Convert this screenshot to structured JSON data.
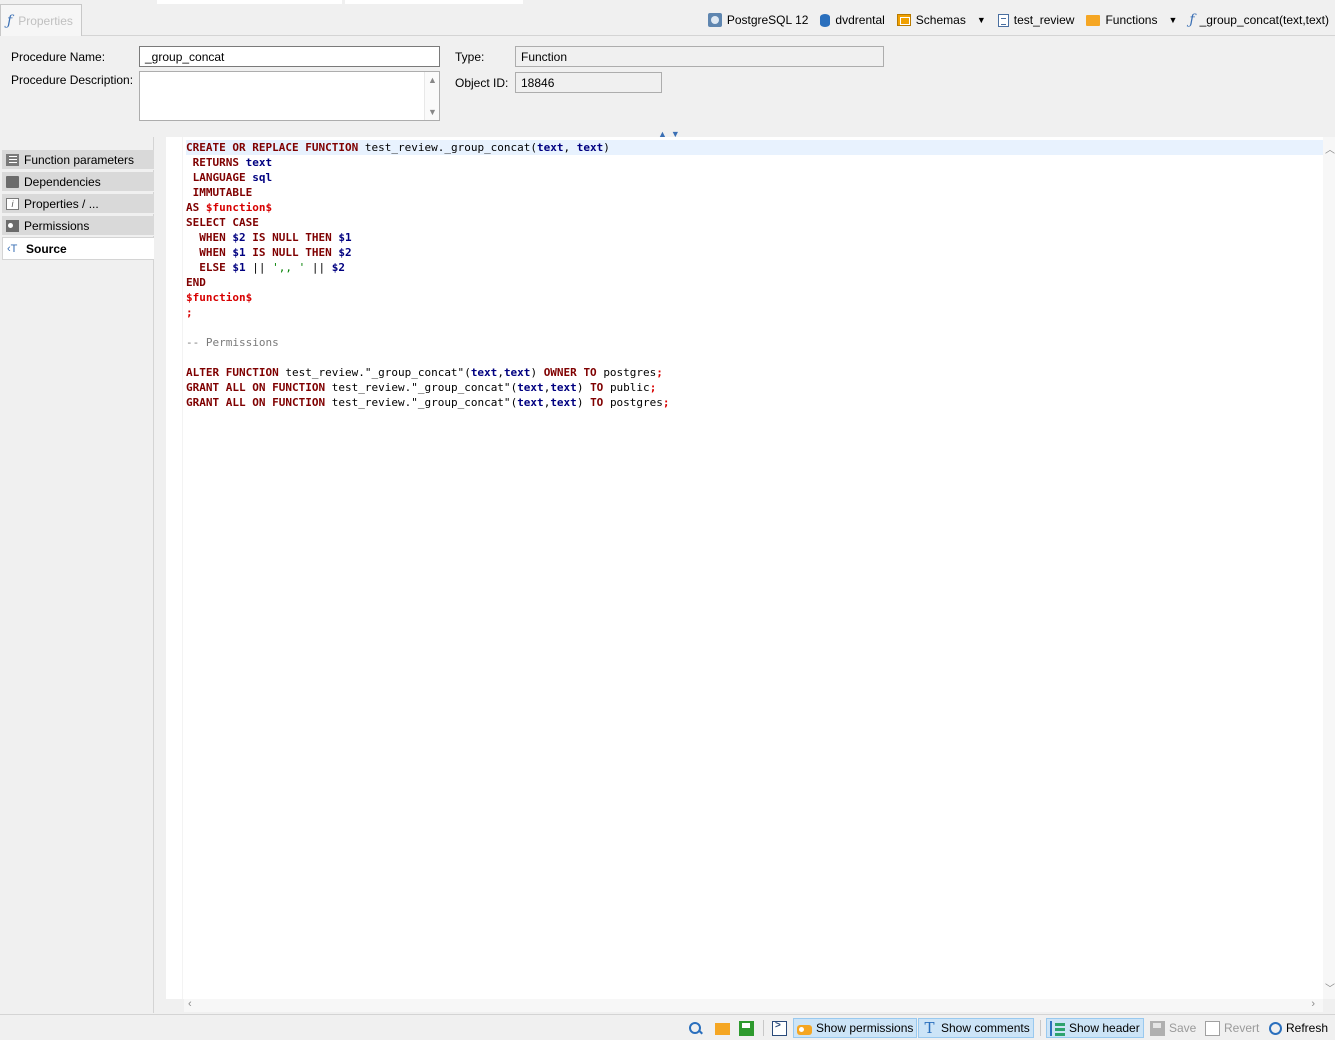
{
  "tab": {
    "label": "Properties"
  },
  "breadcrumb": {
    "server": "PostgreSQL 12",
    "database": "dvdrental",
    "schemas": "Schemas",
    "schema": "test_review",
    "functions": "Functions",
    "function": "_group_concat(text,text)"
  },
  "form": {
    "name_label": "Procedure Name:",
    "name_value": "_group_concat",
    "description_label": "Procedure Description:",
    "description_value": "",
    "type_label": "Type:",
    "type_value": "Function",
    "object_id_label": "Object ID:",
    "object_id_value": "18846"
  },
  "nav": {
    "items": [
      {
        "label": "Function parameters",
        "icon": "list-icon"
      },
      {
        "label": "Dependencies",
        "icon": "folder-icon"
      },
      {
        "label": "Properties / ...",
        "icon": "info-icon"
      },
      {
        "label": "Permissions",
        "icon": "key-icon"
      },
      {
        "label": "Source",
        "icon": "source-icon",
        "active": true
      }
    ]
  },
  "source_lines": [
    "CREATE OR REPLACE FUNCTION test_review._group_concat(text, text)",
    " RETURNS text",
    " LANGUAGE sql",
    " IMMUTABLE",
    "AS $function$",
    "SELECT CASE",
    "  WHEN $2 IS NULL THEN $1",
    "  WHEN $1 IS NULL THEN $2",
    "  ELSE $1 || ',, ' || $2",
    "END",
    "$function$",
    ";",
    "",
    "-- Permissions",
    "",
    "ALTER FUNCTION test_review.\"_group_concat\"(text,text) OWNER TO postgres;",
    "GRANT ALL ON FUNCTION test_review.\"_group_concat\"(text,text) TO public;",
    "GRANT ALL ON FUNCTION test_review.\"_group_concat\"(text,text) TO postgres;"
  ],
  "toolbar": {
    "show_permissions": "Show permissions",
    "show_comments": "Show comments",
    "show_header": "Show header",
    "save": "Save",
    "revert": "Revert",
    "refresh": "Refresh"
  }
}
